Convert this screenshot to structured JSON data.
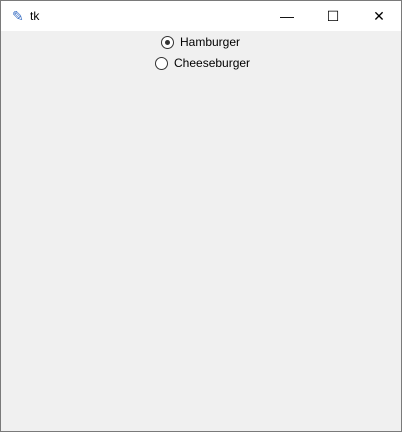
{
  "window": {
    "title": "tk",
    "minimize": "—",
    "maximize": "☐",
    "close": "✕"
  },
  "radios": [
    {
      "label": "Hamburger",
      "selected": true
    },
    {
      "label": "Cheeseburger",
      "selected": false
    }
  ]
}
